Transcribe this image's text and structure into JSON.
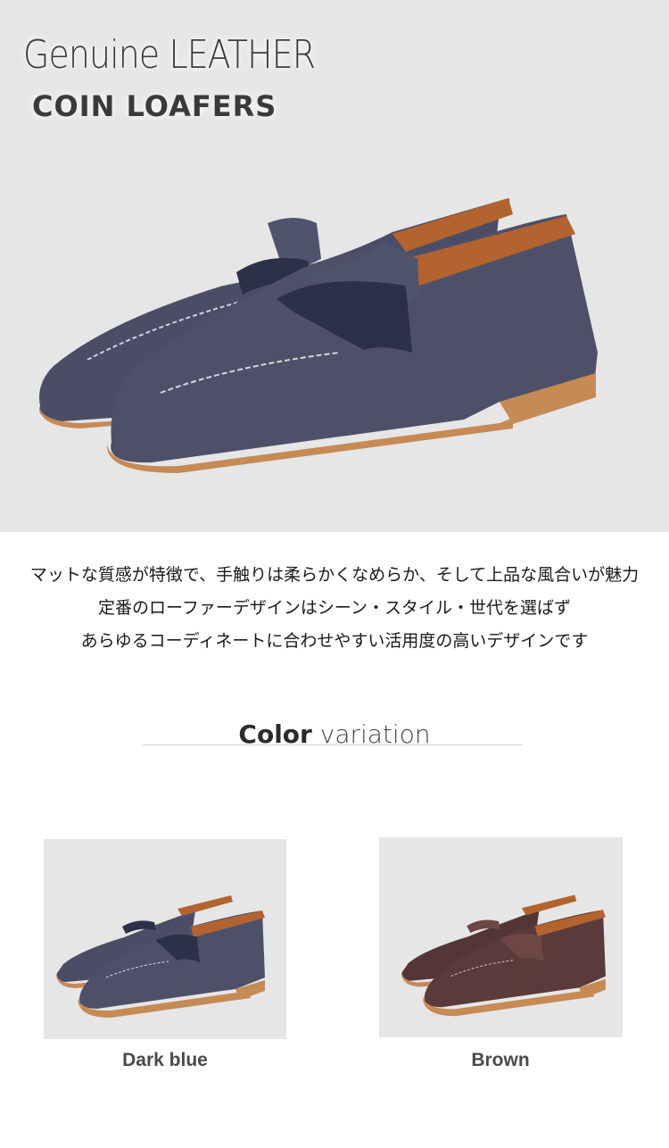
{
  "hero": {
    "title_line1": "Genuine LEATHER",
    "title_line2": "COIN LOAFERS",
    "background": "#e6e6e6"
  },
  "description": {
    "lines": [
      "マットな質感が特徴で、手触りは柔らかくなめらか、そして上品な風合いが魅力",
      "定番のローファーデザインはシーン・スタイル・世代を選ばず",
      "あらゆるコーディネートに合わせやすい活用度の高いデザインです"
    ]
  },
  "color_section": {
    "heading_bold": "Color",
    "heading_light": "variation",
    "variants": [
      {
        "label": "Dark blue",
        "upper_color": "#4e5069",
        "strap_color": "#2c3147"
      },
      {
        "label": "Brown",
        "upper_color": "#5a3a3a",
        "strap_color": "#6e4644"
      }
    ]
  },
  "colors": {
    "sole": "#c68a55",
    "lining": "#b3632f"
  }
}
